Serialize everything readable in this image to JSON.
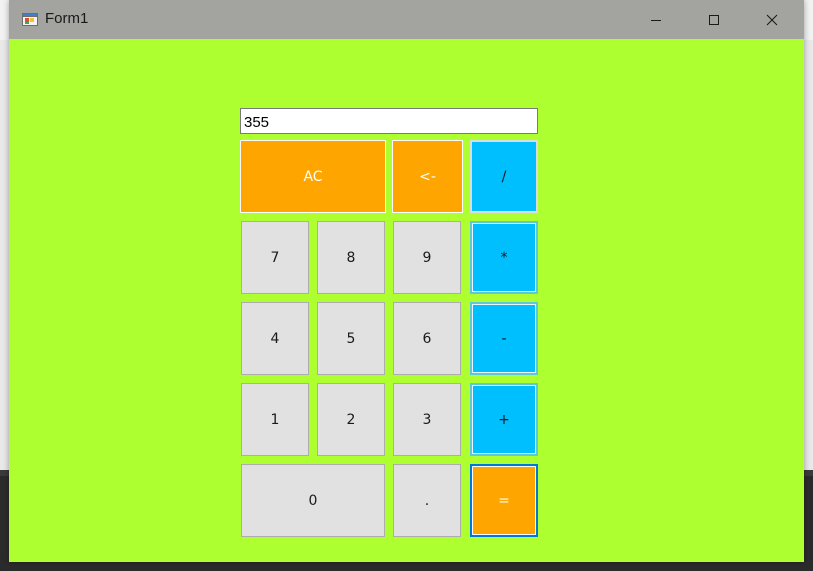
{
  "window": {
    "title": "Form1",
    "background_color": "#adff2f",
    "icons": {
      "app": "form-app-icon",
      "minimize": "minimize-icon",
      "maximize": "maximize-icon",
      "close": "close-icon"
    }
  },
  "calculator": {
    "display_value": "355",
    "keys": {
      "clear": "AC",
      "backspace": "<-",
      "divide": "/",
      "multiply": "*",
      "subtract": "-",
      "add": "+",
      "equals": "=",
      "decimal": ".",
      "d0": "0",
      "d1": "1",
      "d2": "2",
      "d3": "3",
      "d4": "4",
      "d5": "5",
      "d6": "6",
      "d7": "7",
      "d8": "8",
      "d9": "9"
    },
    "colors": {
      "operator": "#00bfff",
      "action": "#ffa500",
      "digit": "#e1e1e1",
      "focus_border": "#0078d7"
    }
  }
}
